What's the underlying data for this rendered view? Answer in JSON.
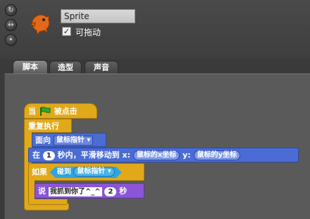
{
  "sprite": {
    "name": "Sprite",
    "draggable_label": "可拖动",
    "draggable_checked": true,
    "rotation_buttons": [
      "rotate-all-icon",
      "flip-lr-icon",
      "no-rotate-icon"
    ],
    "rotation_glyphs": [
      "↻",
      "↔",
      "•"
    ]
  },
  "tabs": [
    {
      "label": "脚本",
      "active": true
    },
    {
      "label": "造型",
      "active": false
    },
    {
      "label": "声音",
      "active": false
    }
  ],
  "script": {
    "hat_when": "当",
    "hat_clicked": "被点击",
    "forever": "重复执行",
    "point_towards": "面向",
    "point_target": "鼠标指针",
    "glide_in": "在",
    "glide_secs": "1",
    "glide_mid": "秒内，平滑移动到 x:",
    "glide_x": "鼠标的x坐标",
    "glide_y_label": "y:",
    "glide_y": "鼠标的y坐标",
    "if_label": "如果",
    "touching": "碰到",
    "touching_target": "鼠标指针",
    "say_label": "说",
    "say_text": "我抓到你了^_^",
    "say_secs": "2",
    "say_unit": "秒"
  },
  "colors": {
    "control": "#e1a91a",
    "motion": "#4a6cd4",
    "looks": "#8a55d7",
    "sensing": "#2ca5e2",
    "flag": "#2ea82e"
  }
}
